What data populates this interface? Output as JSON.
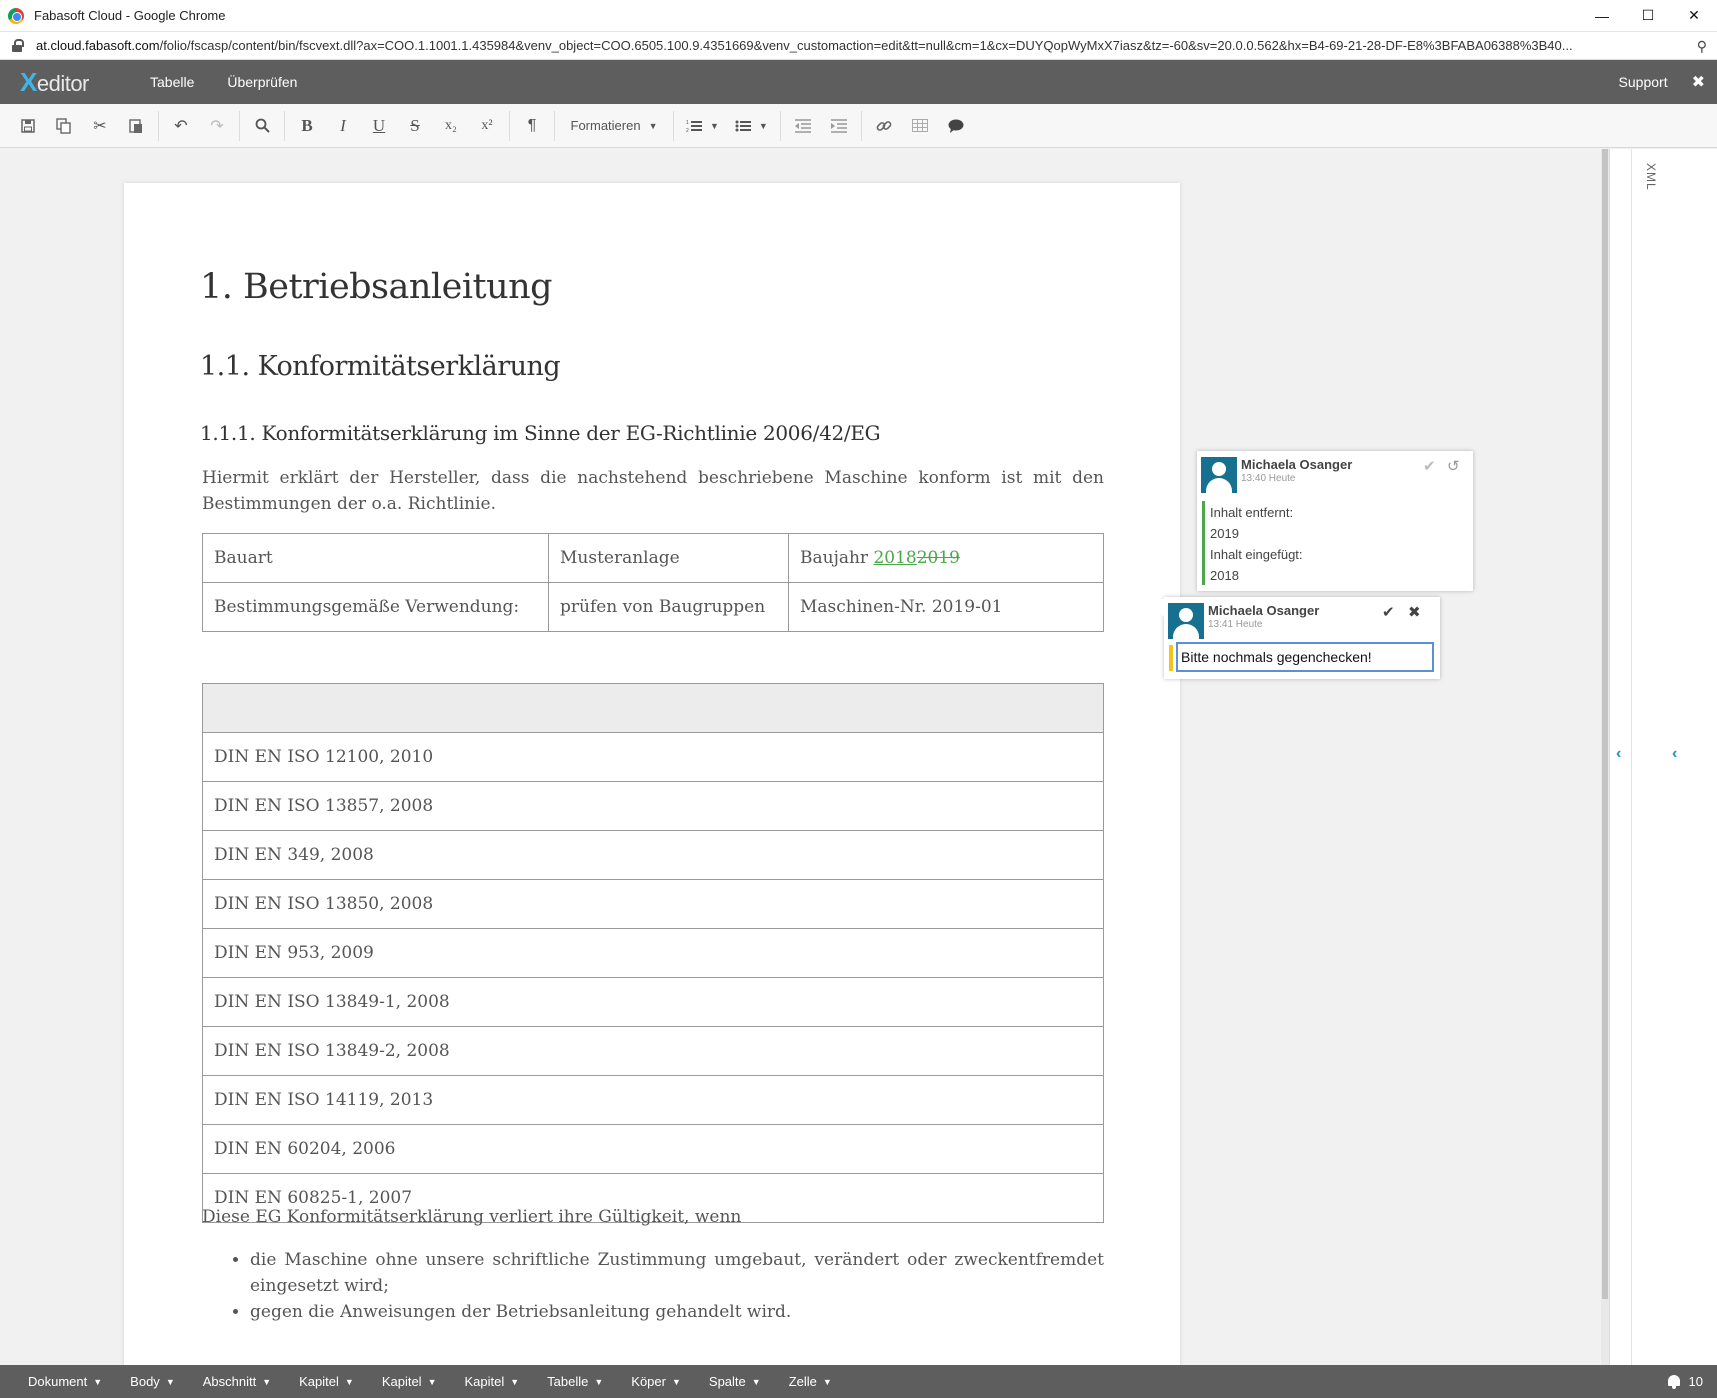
{
  "window": {
    "title": "Fabasoft Cloud - Google Chrome",
    "minimize": "—",
    "maximize": "☐",
    "close": "✕"
  },
  "browser": {
    "url_host": "at.cloud.fabasoft.com",
    "url_rest": "/folio/fscasp/content/bin/fscvext.dll?ax=COO.1.1001.1.435984&venv_object=COO.6505.100.9.4351669&venv_customaction=edit&tt=null&cm=1&cx=DUYQopWyMxX7iasz&tz=-60&sv=20.0.0.562&hx=B4-69-21-28-DF-E8%3BFABA06388%3B40..."
  },
  "app": {
    "logo_x": "X",
    "logo_rest": "editor",
    "menu": [
      "Tabelle",
      "Überprüfen"
    ],
    "support": "Support",
    "close": "✖"
  },
  "toolbar": {
    "format_label": "Formatieren"
  },
  "document": {
    "h1": "1. Betriebsanleitung",
    "h2": "1.1. Konformitätserklärung",
    "h3": "1.1.1. Konformitätserklärung im Sinne der EG-Richtlinie 2006/42/EG",
    "intro": "Hiermit erklärt der Hersteller, dass die nachstehend beschriebene Maschine konform ist mit den Bestimmungen der o.a. Richtlinie.",
    "table1": {
      "r1c1": "Bauart",
      "r1c2": "Musteranlage",
      "r1c3_prefix": "Baujahr ",
      "r1c3_inserted": "2018",
      "r1c3_deleted": "2019",
      "r2c1": "Bestimmungsgemäße Verwendung:",
      "r2c2": "prüfen von Baugruppen",
      "r2c3": "Maschinen-Nr. 2019-01"
    },
    "standards": [
      "DIN EN ISO 12100, 2010",
      "DIN EN ISO 13857, 2008",
      "DIN EN 349, 2008",
      "DIN EN ISO 13850, 2008",
      "DIN EN 953, 2009",
      "DIN EN ISO 13849-1, 2008",
      "DIN EN ISO 13849-2, 2008",
      "DIN EN ISO 14119, 2013",
      "DIN EN 60204, 2006",
      "DIN EN 60825-1, 2007"
    ],
    "outro": "Diese EG Konformitätserklärung verliert ihre Gültigkeit, wenn",
    "bullets": [
      "die Maschine ohne unsere schriftliche Zustimmung umgebaut, verändert oder zweckentfremdet eingesetzt wird;",
      "gegen die Anweisungen der Betriebsanleitung gehandelt wird."
    ]
  },
  "comments": [
    {
      "author": "Michaela Osanger",
      "time": "13:40 Heute",
      "lines": [
        "Inhalt entfernt:",
        "2019",
        "Inhalt eingefügt:",
        "2018"
      ]
    },
    {
      "author": "Michaela Osanger",
      "time": "13:41 Heute",
      "text": "Bitte nochmals gegenchecken!"
    }
  ],
  "sidepanel": {
    "xml": "XML"
  },
  "statusbar": {
    "items": [
      "Dokument",
      "Body",
      "Abschnitt",
      "Kapitel",
      "Kapitel",
      "Kapitel",
      "Tabelle",
      "Köper",
      "Spalte",
      "Zelle"
    ],
    "notifications": "10"
  },
  "colors": {
    "appbar": "#5e5e5e",
    "accent": "#3fb4e6",
    "tracked_change": "#4aa84a",
    "comment_marker": "#f3c31c",
    "avatar": "#17708f"
  }
}
